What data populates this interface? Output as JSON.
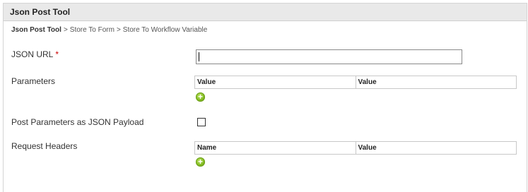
{
  "window": {
    "title": "Json Post Tool"
  },
  "breadcrumb": {
    "items": [
      "Json Post Tool",
      "Store To Form",
      "Store To Workflow Variable"
    ],
    "separator": ">"
  },
  "form": {
    "json_url": {
      "label": "JSON URL",
      "required_mark": "*",
      "value": ""
    },
    "parameters": {
      "label": "Parameters",
      "columns": [
        "Value",
        "Value"
      ],
      "add_icon": "add-circle-icon"
    },
    "post_as_json": {
      "label": "Post Parameters as JSON Payload",
      "checked": false
    },
    "request_headers": {
      "label": "Request Headers",
      "columns": [
        "Name",
        "Value"
      ],
      "add_icon": "add-circle-icon"
    }
  },
  "colors": {
    "titlebar_bg": "#e9e9e9",
    "required": "#cc0000",
    "add_icon": "#84bd24"
  }
}
